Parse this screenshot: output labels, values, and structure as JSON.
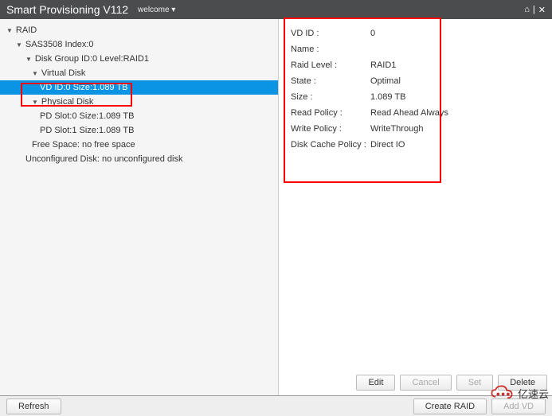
{
  "header": {
    "title": "Smart Provisioning V112",
    "welcome": "welcome ▾",
    "home_icon": "⌂",
    "sep": "|",
    "close_icon": "✕"
  },
  "tree": {
    "raid": "RAID",
    "controller": "SAS3508 Index:0",
    "diskgroup": "Disk Group ID:0 Level:RAID1",
    "virtualdisk": "Virtual Disk",
    "vd": "VD ID:0 Size:1.089 TB",
    "physicaldisk": "Physical Disk",
    "pd0": "PD Slot:0 Size:1.089 TB",
    "pd1": "PD Slot:1 Size:1.089 TB",
    "freespace": "Free Space: no free space",
    "unconfigured": "Unconfigured Disk: no unconfigured disk"
  },
  "details": [
    {
      "label": "VD ID :",
      "value": "0"
    },
    {
      "label": "Name :",
      "value": ""
    },
    {
      "label": "Raid Level :",
      "value": "RAID1"
    },
    {
      "label": "State :",
      "value": "Optimal"
    },
    {
      "label": "Size :",
      "value": "1.089 TB"
    },
    {
      "label": "Read Policy :",
      "value": "Read Ahead Always"
    },
    {
      "label": "Write Policy :",
      "value": "WriteThrough"
    },
    {
      "label": "Disk Cache Policy :",
      "value": "Direct IO"
    }
  ],
  "buttons": {
    "edit": "Edit",
    "cancel": "Cancel",
    "set": "Set",
    "delete": "Delete",
    "refresh": "Refresh",
    "createraid": "Create RAID",
    "addvd": "Add VD"
  },
  "watermark": "亿速云"
}
